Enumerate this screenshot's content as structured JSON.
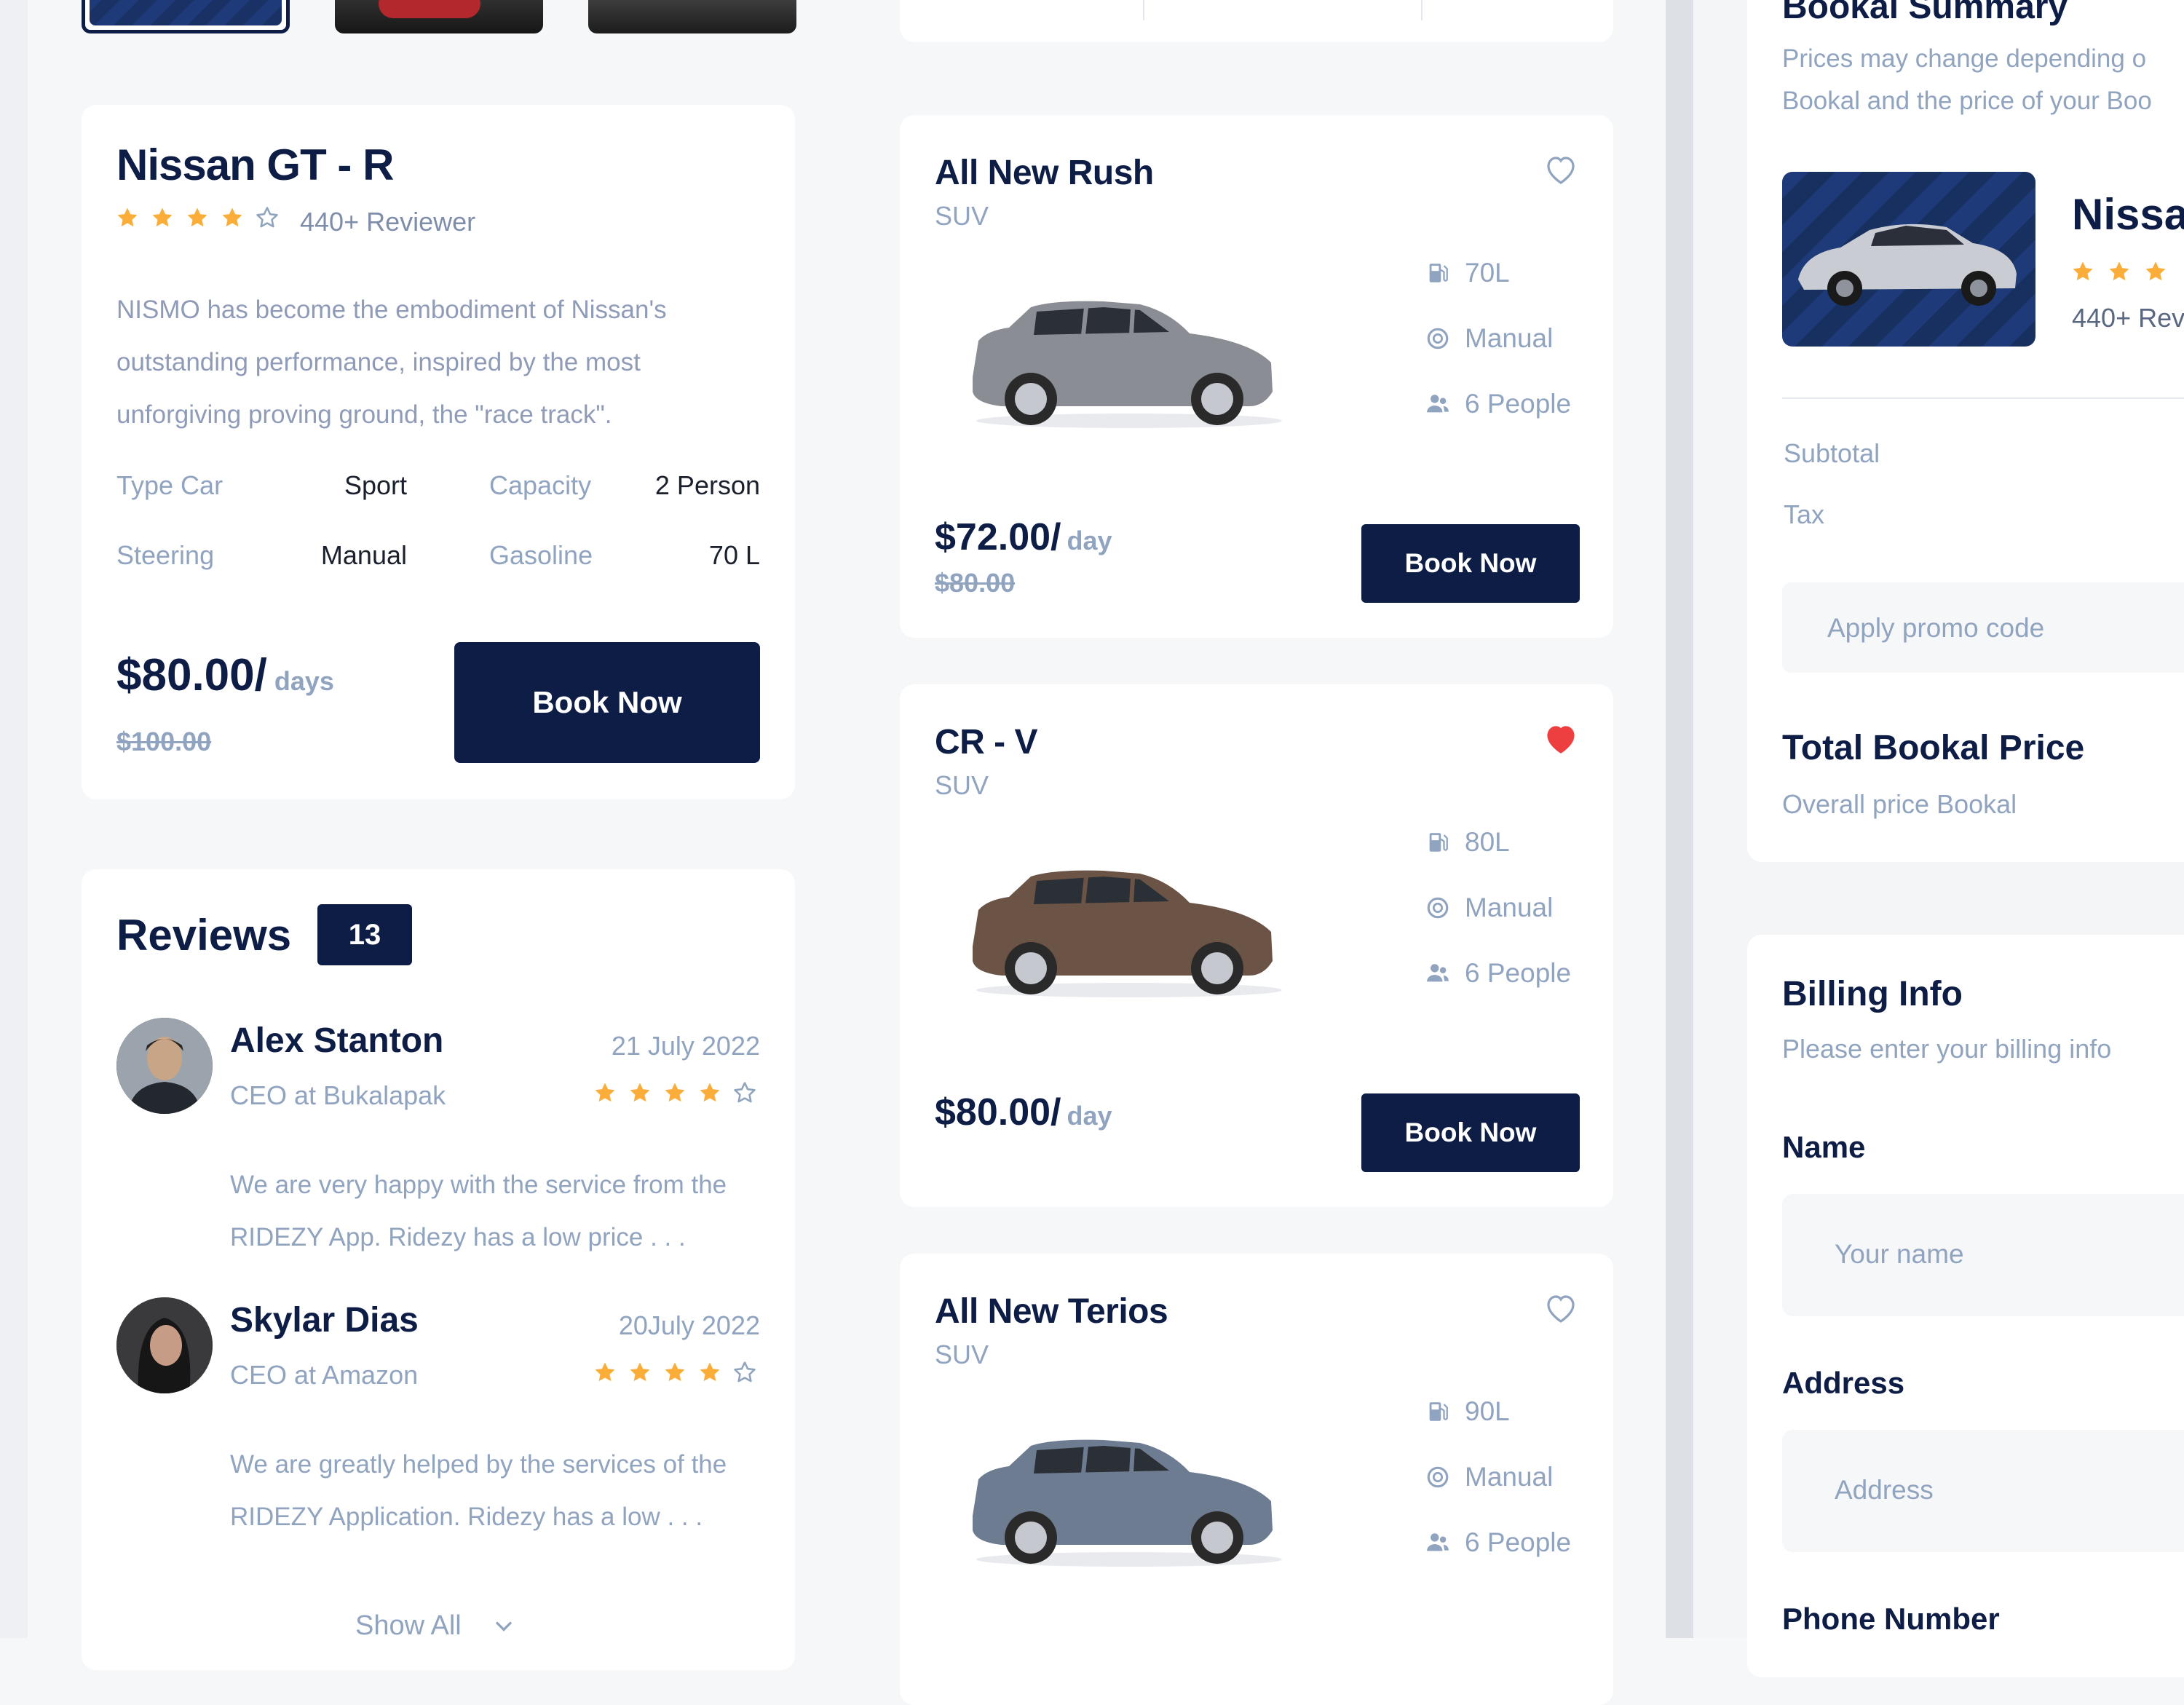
{
  "detail": {
    "name": "Nissan GT - R",
    "rating": 4,
    "reviewers": "440+ Reviewer",
    "description_lines": [
      "NISMO has become the embodiment of Nissan's",
      "outstanding performance, inspired by the most",
      "unforgiving proving ground, the \"race track\"."
    ],
    "specs": [
      {
        "label": "Type Car",
        "value": "Sport"
      },
      {
        "label": "Capacity",
        "value": "2 Person"
      },
      {
        "label": "Steering",
        "value": "Manual"
      },
      {
        "label": "Gasoline",
        "value": "70 L"
      }
    ],
    "price": "$80.00/",
    "per": "days",
    "old_price": "$100.00",
    "button": "Book Now"
  },
  "reviews": {
    "title": "Reviews",
    "count": "13",
    "items": [
      {
        "name": "Alex Stanton",
        "role": "CEO at Bukalapak",
        "date": "21 July 2022",
        "rating": 4,
        "text_lines": [
          "We are very happy with the service from the",
          "RIDEZY App. Ridezy has a low price . . ."
        ]
      },
      {
        "name": "Skylar Dias",
        "role": "CEO at Amazon",
        "date": "20July 2022",
        "rating": 4,
        "text_lines": [
          "We are greatly helped by the services of the",
          "RIDEZY Application. Ridezy has a low . . ."
        ]
      }
    ],
    "show_all": "Show All"
  },
  "cars": [
    {
      "name": "All New Rush",
      "type": "SUV",
      "fuel": "70L",
      "steering": "Manual",
      "capacity": "6 People",
      "price": "$72.00/",
      "per": "day",
      "old_price": "$80.00",
      "button": "Book Now",
      "liked": false,
      "color": "#8A8E94"
    },
    {
      "name": "CR - V",
      "type": "SUV",
      "fuel": "80L",
      "steering": "Manual",
      "capacity": "6 People",
      "price": "$80.00/",
      "per": "day",
      "old_price": "",
      "button": "Book Now",
      "liked": true,
      "color": "#6B5446"
    },
    {
      "name": "All New Terios",
      "type": "SUV",
      "fuel": "90L",
      "steering": "Manual",
      "capacity": "6 People",
      "liked": false,
      "color": "#6D7C90"
    }
  ],
  "summary": {
    "title": "Bookal Summary",
    "note_lines": [
      "Prices may change depending o",
      "Bookal and the price of your Boo"
    ],
    "car_name": "Nissa",
    "car_reviewers": "440+ Rev",
    "subtotal": "Subtotal",
    "tax": "Tax",
    "promo_placeholder": "Apply promo code",
    "total_title": "Total Bookal Price",
    "total_sub": "Overall price Bookal"
  },
  "billing": {
    "title": "Billing Info",
    "subtitle": "Please enter your billing info",
    "name_label": "Name",
    "name_placeholder": "Your name",
    "address_label": "Address",
    "address_placeholder": "Address",
    "phone_label": "Phone Number"
  },
  "colors": {
    "navy": "#0E1D45",
    "muted": "#90A3BF",
    "star": "#FBAD39",
    "heart_red": "#ED3F3F"
  }
}
